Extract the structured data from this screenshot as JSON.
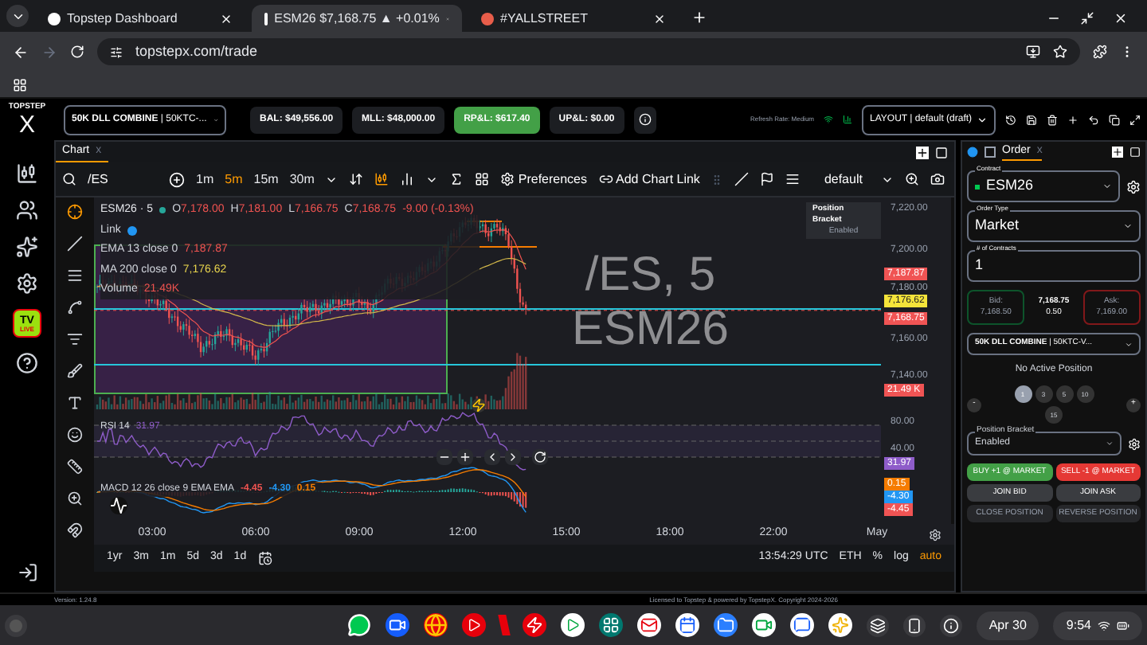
{
  "browser": {
    "tabs": [
      {
        "title": "Topstep Dashboard",
        "selected": false
      },
      {
        "title": "ESM26 $7,168.75 ▲ +0.01%",
        "selected": true
      },
      {
        "title": "#YALLSTREET",
        "selected": false
      }
    ],
    "url": "topstepx.com/trade"
  },
  "header": {
    "logo": "TOPSTEP",
    "logo_mark": "X",
    "account": "**50K DLL COMBINE** | 50KTC-...",
    "stats": [
      {
        "label": "BAL: $49,556.00",
        "highlighted": false
      },
      {
        "label": "MLL: $48,000.00",
        "highlighted": false
      },
      {
        "label": "RP&L: $617.40",
        "highlighted": true
      },
      {
        "label": "UP&L: $0.00",
        "highlighted": false
      }
    ],
    "refresh": "Refresh Rate: Medium",
    "layout": "LAYOUT | default (draft)"
  },
  "sidebar": {
    "live_badge": {
      "top": "TV",
      "bottom": "LIVE"
    }
  },
  "chart": {
    "tab": "Chart",
    "tab_close": "x",
    "symbol": "/ES",
    "intervals": [
      {
        "label": "1m",
        "selected": false
      },
      {
        "label": "5m",
        "selected": true
      },
      {
        "label": "15m",
        "selected": false
      },
      {
        "label": "30m",
        "selected": false
      }
    ],
    "preferences": "Preferences",
    "add_link": "Add Chart Link",
    "template": "default",
    "legend": {
      "title": "ESM26 · 5",
      "ohlc": [
        {
          "key": "O",
          "value": "7,178.00"
        },
        {
          "key": "H",
          "value": "7,181.00"
        },
        {
          "key": "L",
          "value": "7,166.75"
        },
        {
          "key": "C",
          "value": "7,168.75"
        }
      ],
      "change": "-9.00 (-0.13%)",
      "link": "Link",
      "indicators": [
        {
          "name": "EMA 13 close 0",
          "value": "7,187.87",
          "color": "#ef5350"
        },
        {
          "name": "MA 200 close 0",
          "value": "7,176.62",
          "color": "#e8d44d"
        },
        {
          "name": "Volume",
          "value": "21.49K",
          "color": "#ef5350"
        }
      ]
    },
    "watermark": [
      "/ES, 5",
      "ESM26"
    ],
    "tooltip": {
      "title": "Position Bracket",
      "value": "Enabled"
    },
    "price_labels": [
      "7,220.00",
      "7,200.00",
      "7,180.00",
      "7,160.00",
      "7,140.00",
      "80.00",
      "40.00"
    ],
    "price_tags": [
      {
        "text": "7,187.87",
        "color": "#f05454"
      },
      {
        "text": "7,176.62",
        "color": "#f5e43a"
      },
      {
        "text": "7,168.75",
        "color": "#f05454"
      },
      {
        "text": "21.49 K",
        "color": "#f05454"
      },
      {
        "text": "31.97",
        "color": "#8e5cc9"
      },
      {
        "text": "0.15",
        "color": "#f57c00"
      },
      {
        "text": "-4.30",
        "color": "#2196f3"
      },
      {
        "text": "-4.45",
        "color": "#f05454"
      }
    ],
    "rsi": {
      "label": "RSI 14",
      "value": "31.97"
    },
    "macd": {
      "label": "MACD 12 26 close 9 EMA EMA",
      "values": [
        {
          "text": "-4.45",
          "color": "#ef5350"
        },
        {
          "text": "-4.30",
          "color": "#2196f3"
        },
        {
          "text": "0.15",
          "color": "#f57c00"
        }
      ]
    },
    "time_labels": [
      "03:00",
      "06:00",
      "09:00",
      "12:00",
      "15:00",
      "18:00",
      "22:00",
      "May"
    ],
    "ranges": [
      "1yr",
      "3m",
      "1m",
      "5d",
      "3d",
      "1d"
    ],
    "clock": "13:54:29 UTC",
    "session": "ETH",
    "scale_options": [
      {
        "label": "%",
        "selected": false
      },
      {
        "label": "log",
        "selected": false
      },
      {
        "label": "auto",
        "selected": true
      }
    ]
  },
  "order": {
    "title": "Order",
    "close": "x",
    "contract": {
      "label": "Contract",
      "value": "ESM26"
    },
    "order_type": {
      "label": "Order Type",
      "value": "Market"
    },
    "contracts": {
      "label": "# of Contracts",
      "value": "1"
    },
    "bid": {
      "label": "Bid:",
      "value": "7,168.50"
    },
    "last": {
      "price": "7,168.75",
      "spread": "0.50"
    },
    "ask": {
      "label": "Ask:",
      "value": "7,169.00"
    },
    "account": "**50K DLL COMBINE** | 50KTC-V...",
    "position": "No Active Position",
    "minus": "-",
    "plus": "+",
    "quantities": [
      {
        "label": "1",
        "selected": true
      },
      {
        "label": "3",
        "selected": false
      },
      {
        "label": "5",
        "selected": false
      },
      {
        "label": "10",
        "selected": false
      },
      {
        "label": "15",
        "selected": false
      }
    ],
    "bracket": {
      "label": "Position Bracket",
      "value": "Enabled"
    },
    "actions": [
      {
        "label": "BUY +1 @ MARKET",
        "kind": "buy",
        "disabled": false
      },
      {
        "label": "SELL -1 @ MARKET",
        "kind": "sell",
        "disabled": false
      },
      {
        "label": "JOIN BID",
        "kind": "neutral",
        "disabled": false
      },
      {
        "label": "JOIN ASK",
        "kind": "neutral",
        "disabled": false
      },
      {
        "label": "CLOSE POSITION",
        "kind": "neutral",
        "disabled": true
      },
      {
        "label": "REVERSE POSITION",
        "kind": "neutral",
        "disabled": true
      }
    ]
  },
  "footer": {
    "version": "Version: 1.24.8",
    "license": "Licensed to Topstep & powered by TopstepX. Copyright 2024-2026"
  },
  "taskbar": {
    "date": "Apr 30",
    "time": "9:54"
  }
}
